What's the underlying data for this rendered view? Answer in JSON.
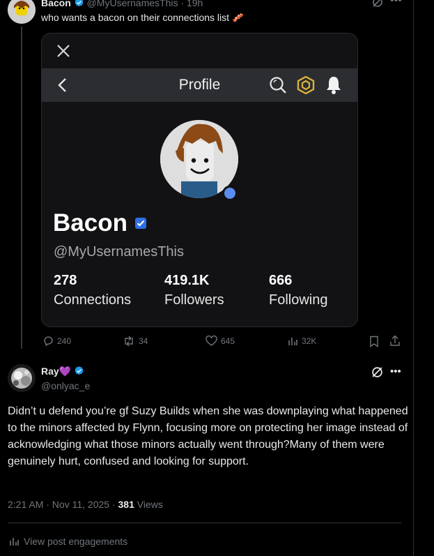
{
  "tweet1": {
    "author_name": "Bacon",
    "handle": "@MyUsernamesThis",
    "time": "· 19h",
    "text": "who wants a bacon on their connections list 🥓",
    "card": {
      "header_title": "Profile",
      "profile_name": "Bacon",
      "profile_handle": "@MyUsernamesThis",
      "stats": [
        {
          "value": "278",
          "label": "Connections"
        },
        {
          "value": "419.1K",
          "label": "Followers"
        },
        {
          "value": "666",
          "label": "Following"
        }
      ]
    },
    "actions": {
      "replies": "240",
      "reposts": "34",
      "likes": "645",
      "views": "32K"
    }
  },
  "tweet2": {
    "author_name": "Ray💜",
    "handle": "@onlyac_e",
    "text": "Didn’t u defend you’re gf Suzy Builds when she was downplaying what happened to the minors affected by Flynn, focusing more on protecting her image instead of acknowledging what those minors actually went through?Many of them were genuinely hurt, confused and looking for support.",
    "timestamp": "2:21 AM · Nov 11, 2025 · ",
    "views_count": "381",
    "views_label": " Views",
    "engagements_link": "View post engagements"
  },
  "colors": {
    "verified": "#1d9bf0",
    "background": "#000000",
    "muted": "#71767b",
    "online": "#5b8def"
  },
  "icons": [
    "grok-icon",
    "more-icon",
    "close-icon",
    "back-icon",
    "search-icon",
    "robux-icon",
    "bell-icon",
    "reply-icon",
    "repost-icon",
    "like-icon",
    "views-icon",
    "bookmark-icon",
    "share-icon",
    "verified-icon"
  ]
}
